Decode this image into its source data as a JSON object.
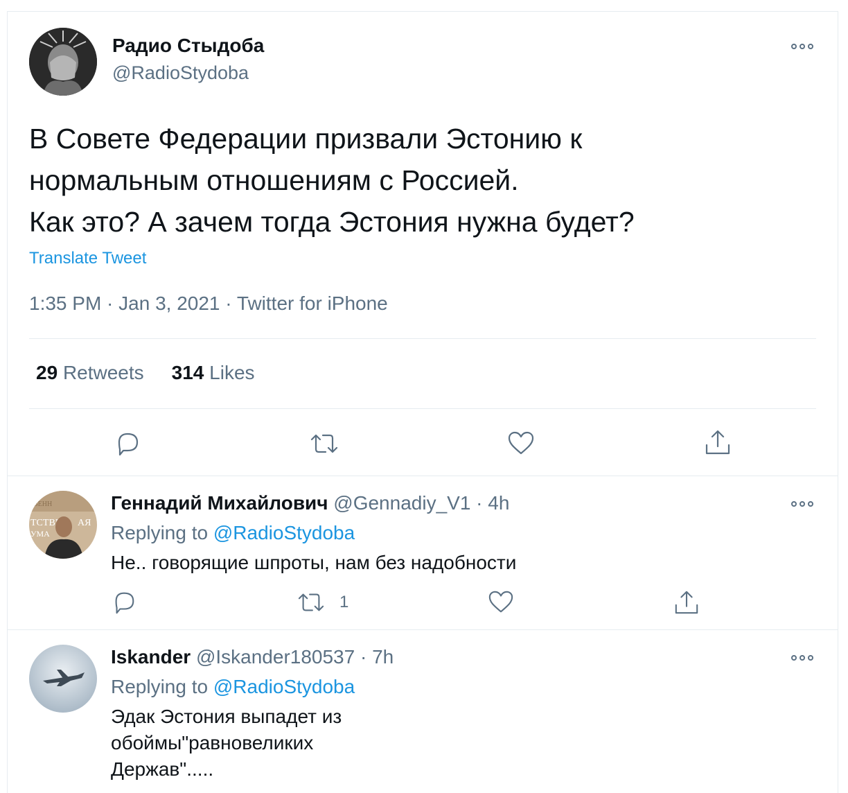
{
  "main_tweet": {
    "author_name": "Радио Стыдоба",
    "author_handle": "@RadioStydoba",
    "text": "В Совете Федерации призвали Эстонию к\nнормальным отношениям с Россией.\nКак это? А зачем тогда Эстония нужна будет?",
    "translate_label": "Translate Tweet",
    "meta": "1:35 PM · Jan 3, 2021 · Twitter for iPhone",
    "retweets_count": "29",
    "retweets_label": "Retweets",
    "likes_count": "314",
    "likes_label": "Likes"
  },
  "replies": [
    {
      "author_name": "Геннадий Михайлович",
      "author_handle": "@Gennadiy_V1",
      "time": "· 4h",
      "replying_prefix": "Replying to",
      "replying_to": "@RadioStydoba",
      "text": "Не.. говорящие шпроты, нам без надобности",
      "retweet_count": "1"
    },
    {
      "author_name": "Iskander",
      "author_handle": "@Iskander180537",
      "time": "· 7h",
      "replying_prefix": "Replying to",
      "replying_to": "@RadioStydoba",
      "text": "Эдак Эстония выпадет из\nобоймы\"равновеликих\nДержав\".....",
      "retweet_count": ""
    }
  ],
  "icons": {
    "reply": "reply-icon",
    "retweet": "retweet-icon",
    "like": "heart-icon",
    "share": "share-icon",
    "more": "more-icon"
  },
  "colors": {
    "link": "#1b95e0",
    "secondary_text": "#5b7083",
    "divider": "#e6ecf0"
  }
}
